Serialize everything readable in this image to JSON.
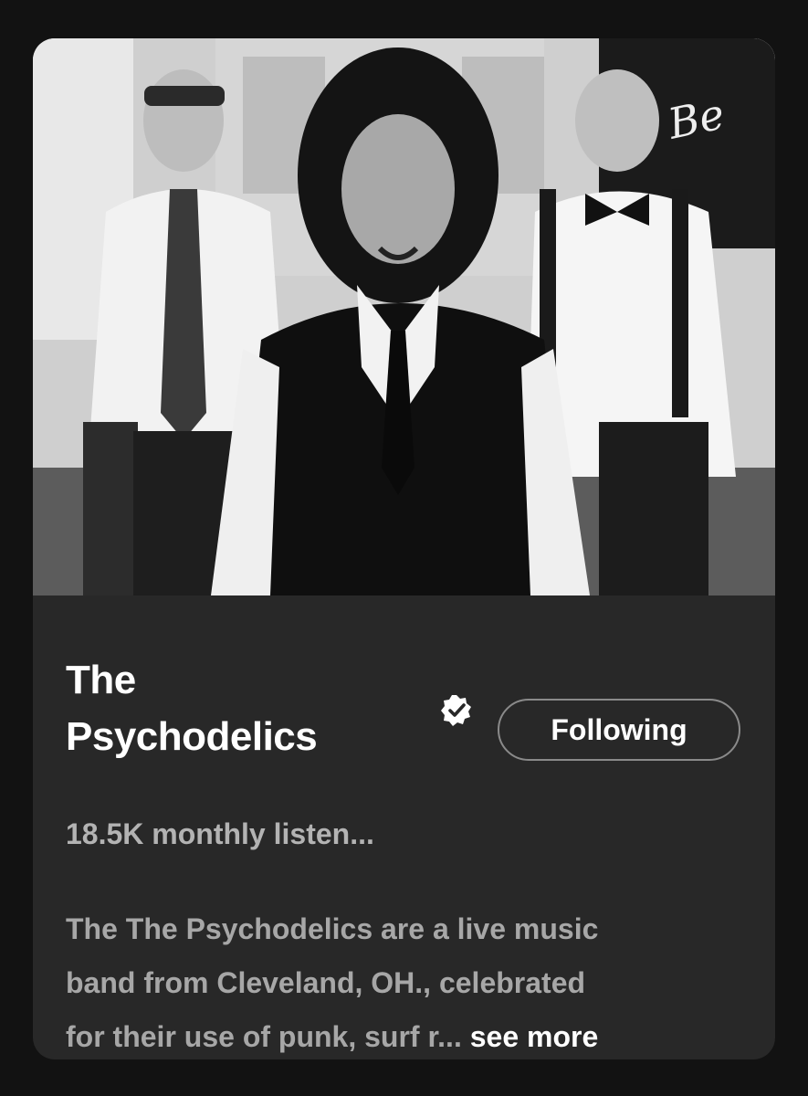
{
  "artist": {
    "name_line1": "The",
    "name_line2": "Psychodelics",
    "verified_icon": "verified-badge-icon",
    "monthly_listeners": "18.5K monthly listen..."
  },
  "actions": {
    "follow_label": "Following"
  },
  "bio": {
    "line1": "The The Psychodelics are a live music",
    "line2": "band from Cleveland, OH., celebrated",
    "line3": "for their use of punk, surf r...",
    "see_more_label": "see more"
  },
  "colors": {
    "card_background": "#282828",
    "page_background": "#121212",
    "primary_text": "#ffffff",
    "secondary_text": "#b3b3b3",
    "button_border": "#8a8a8a"
  }
}
